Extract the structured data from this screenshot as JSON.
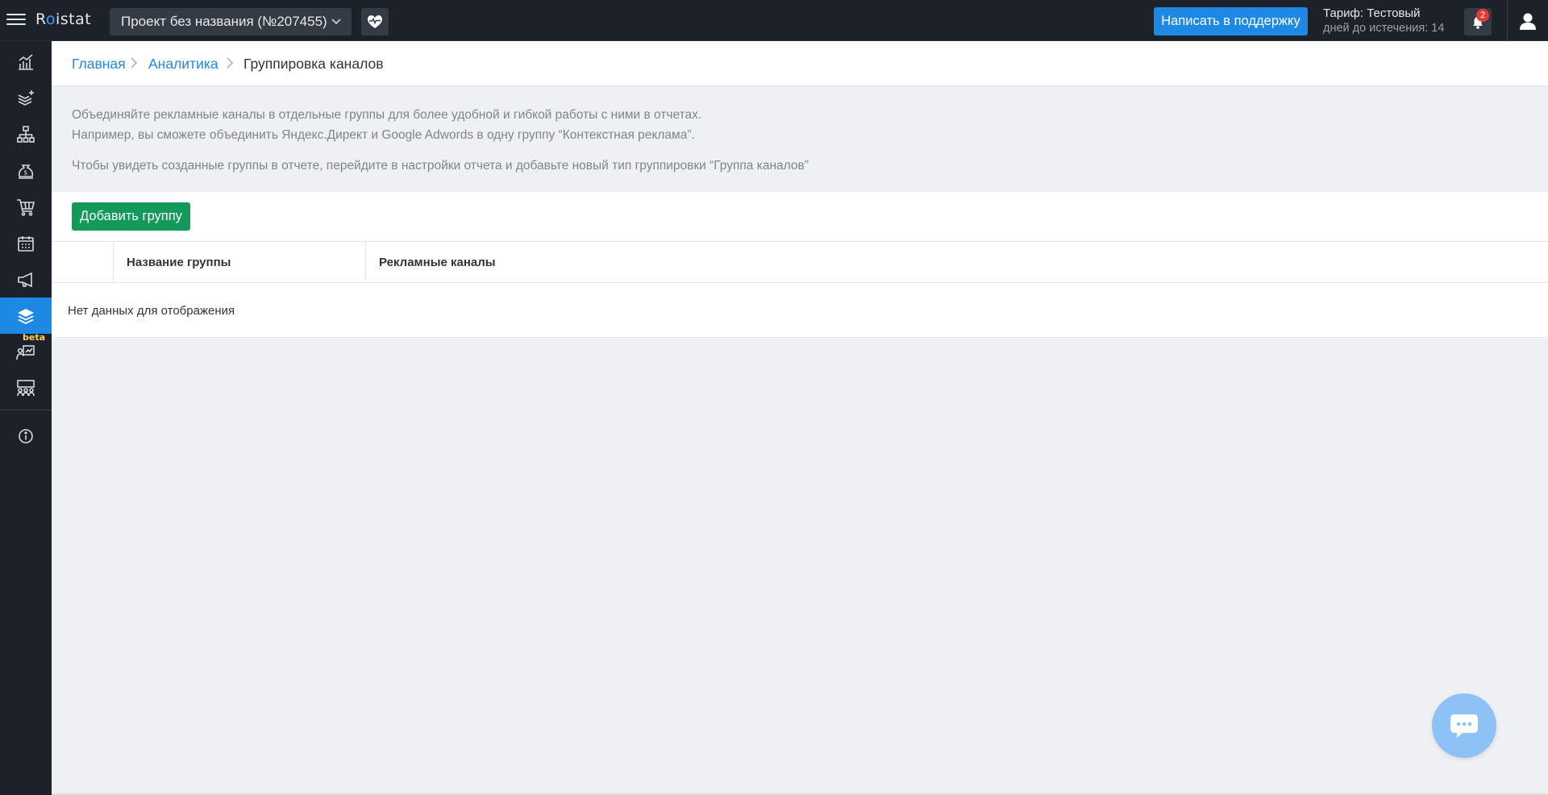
{
  "topbar": {
    "logo_text": "Roistat",
    "project_name": "Проект без названия (№207455)",
    "support_label": "Написать в поддержку",
    "tariff_label": "Тариф: Тестовый",
    "days_left_label": "дней до истечения: 14",
    "notifications_count": "2"
  },
  "sidebar": {
    "items": [
      {
        "icon": "analytics-chart-icon"
      },
      {
        "icon": "layers-plus-icon"
      },
      {
        "icon": "sitemap-icon"
      },
      {
        "icon": "money-bag-icon"
      },
      {
        "icon": "shopping-cart-icon"
      },
      {
        "icon": "calendar-icon"
      },
      {
        "icon": "megaphone-icon"
      },
      {
        "icon": "layers-icon",
        "active": true
      },
      {
        "icon": "presentation-icon"
      },
      {
        "icon": "team-icon"
      },
      {
        "icon": "info-icon"
      }
    ],
    "beta_label": "beta"
  },
  "breadcrumb": {
    "home": "Главная",
    "analytics": "Аналитика",
    "current": "Группировка каналов"
  },
  "info": {
    "line1": "Объединяйте рекламные каналы в отдельные группы для более удобной и гибкой работы с ними в отчетах.",
    "line2": "Например, вы сможете объединить Яндекс.Директ и Google Adwords в одну группу “Контекстная реклама”.",
    "line3": "Чтобы увидеть созданные группы в отчете, перейдите в настройки отчета и добавьте новый тип группировки “Группа каналов”"
  },
  "actions": {
    "add_group_label": "Добавить группу"
  },
  "table": {
    "columns": [
      "",
      "Название группы",
      "Рекламные каналы"
    ],
    "empty_message": "Нет данных для отображения"
  },
  "colors": {
    "topbar_bg": "#1d2129",
    "accent_blue": "#1e88e5",
    "green_button": "#139a5b",
    "page_bg": "#eff0f3"
  }
}
